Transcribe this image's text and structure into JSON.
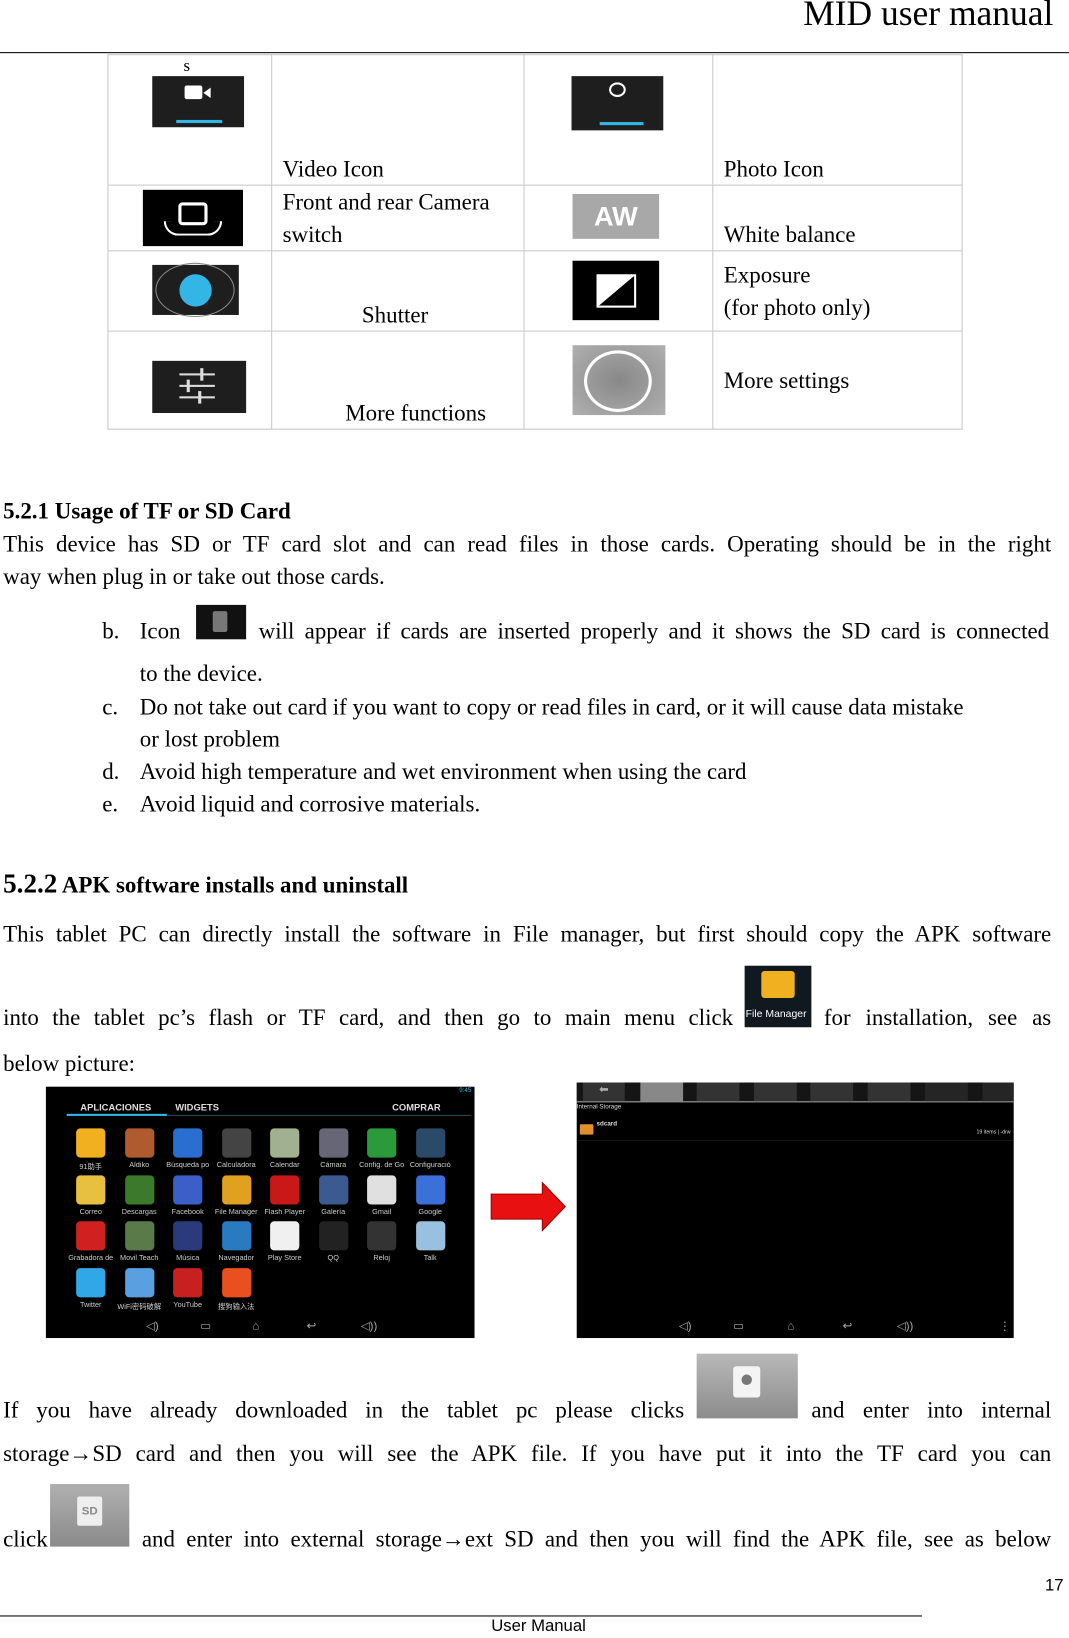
{
  "header": {
    "title": "MID user manual"
  },
  "icon_table": [
    {
      "left_icon": "video-icon",
      "left_label": "Video Icon",
      "right_icon": "photo-icon",
      "right_label": "Photo Icon",
      "stray_mark": "s"
    },
    {
      "left_icon": "camera-switch-icon",
      "left_label": "Front and rear Camera switch",
      "right_icon": "white-balance-icon",
      "right_icon_text": "AW",
      "right_label": "White balance"
    },
    {
      "left_icon": "shutter-icon",
      "left_label": "Shutter",
      "right_icon": "exposure-icon",
      "right_label_1": "Exposure",
      "right_label_2": "(for photo only)"
    },
    {
      "left_icon": "sliders-icon",
      "left_label": "More functions",
      "right_icon": "settings-ring-icon",
      "right_label": "More settings"
    }
  ],
  "section_521": {
    "heading": "5.2.1 Usage of TF or SD Card",
    "para_1": "This device has SD or TF card slot and can read files in those cards. Operating should be in the right",
    "para_2": "way when plug in or take out those cards.",
    "items": [
      {
        "marker": "b.",
        "text_a": "Icon",
        "text_b": "will appear if cards are inserted properly and it shows the SD card is connected",
        "text_c": "to the device."
      },
      {
        "marker": "c.",
        "text_a": "Do not take out card if you want to copy or read files in card, or it will cause data mistake",
        "text_c": "or lost problem"
      },
      {
        "marker": "d.",
        "text_a": "Avoid high temperature and wet environment when using the card"
      },
      {
        "marker": "e.",
        "text_a": "Avoid liquid and corrosive materials."
      }
    ]
  },
  "section_522": {
    "number": "5.2.2",
    "heading": "APK software installs and uninstall",
    "line_1": "This tablet PC can directly install the software in File manager, but first should copy the APK software",
    "line_2a": "into the tablet pc’s flash or TF card, and then go to main menu click",
    "file_manager_icon_label": "File Manager",
    "line_2b": "for installation, see as",
    "line_3": "below picture:",
    "line_4a": "If you have already downloaded in the tablet pc please clicks",
    "line_4b": "and enter into internal",
    "line_5": "storage→SD card and then you will see the APK file. If you have put it into the TF card you can",
    "line_6a": "click",
    "sd_icon_text": "SD",
    "line_6b": "and enter into external storage→ext SD and then you will find the APK file, see as below"
  },
  "app_drawer": {
    "tabs": [
      "APLICACIONES",
      "WIDGETS"
    ],
    "store": "COMPRAR",
    "time": "9:45",
    "apps": [
      {
        "name": "91助手",
        "color": "#f0b020"
      },
      {
        "name": "Aldiko",
        "color": "#b05a30"
      },
      {
        "name": "Búsqueda po",
        "color": "#2a6fd0"
      },
      {
        "name": "Calculadora",
        "color": "#444444"
      },
      {
        "name": "Calendar",
        "color": "#a0b090"
      },
      {
        "name": "Cámara",
        "color": "#666677"
      },
      {
        "name": "Config. de Go",
        "color": "#2a9a3a"
      },
      {
        "name": "Configuració",
        "color": "#2a4a6a"
      },
      {
        "name": "Correo",
        "color": "#e8c040"
      },
      {
        "name": "Descargas",
        "color": "#3a7a2a"
      },
      {
        "name": "Facebook",
        "color": "#3b5ec8"
      },
      {
        "name": "File Manager",
        "color": "#e0a020"
      },
      {
        "name": "Flash Player",
        "color": "#c81818"
      },
      {
        "name": "Galería",
        "color": "#3a5a90"
      },
      {
        "name": "Gmail",
        "color": "#e0e0e0"
      },
      {
        "name": "Google",
        "color": "#3a70d8"
      },
      {
        "name": "Grabadora de",
        "color": "#d02020"
      },
      {
        "name": "Movil Teach",
        "color": "#5a7a4a"
      },
      {
        "name": "Música",
        "color": "#2a3a7a"
      },
      {
        "name": "Navegador",
        "color": "#2a7ac0"
      },
      {
        "name": "Play Store",
        "color": "#f0f0f0"
      },
      {
        "name": "QQ",
        "color": "#222222"
      },
      {
        "name": "Reloj",
        "color": "#333333"
      },
      {
        "name": "Talk",
        "color": "#9ac0e0"
      },
      {
        "name": "Twitter",
        "color": "#30a8e8"
      },
      {
        "name": "WiFi密码破解",
        "color": "#5aa0e0"
      },
      {
        "name": "YouTube",
        "color": "#c82020"
      },
      {
        "name": "搜狗输入法",
        "color": "#e85020"
      }
    ]
  },
  "file_manager": {
    "path": "Internal Storage",
    "folder": "sdcard",
    "meta": "19 items | -drw"
  },
  "colors": {
    "arrow": "#e81010",
    "accent": "#33b5e5"
  },
  "footer": {
    "page_number": "17",
    "label": "User Manual"
  }
}
